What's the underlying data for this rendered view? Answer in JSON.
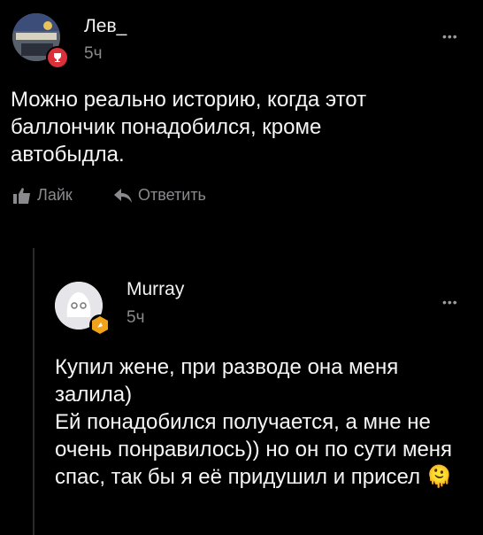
{
  "comment": {
    "author": "Лев_",
    "time": "5ч",
    "menu": "•••",
    "text": "Можно реально историю, когда этот баллончик понадобился, кроме автобыдла.",
    "actions": {
      "like": "Лайк",
      "reply": "Ответить"
    }
  },
  "reply": {
    "author": "Murray",
    "time": "5ч",
    "menu": "•••",
    "text": "Купил жене, при разводе она меня залила)\nЕй понадобился получается, а мне не очень понравилось)) но он по сути меня спас, так бы я её придушил и присел",
    "emoji": "🫠"
  },
  "colors": {
    "background": "#000000",
    "text": "#f5f5f5",
    "muted": "#8a8a8e",
    "badge_red": "#d9303a",
    "badge_orange": "#f0a21a"
  }
}
